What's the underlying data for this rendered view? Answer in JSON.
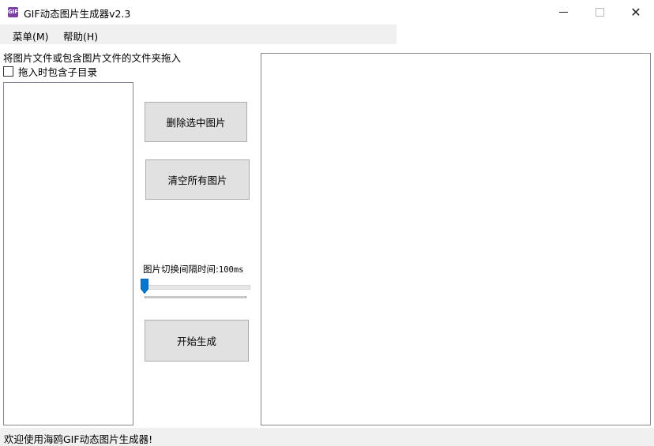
{
  "window": {
    "title": "GIF动态图片生成器v2.3",
    "icon_text": "GIF",
    "minimize_glyph": "—",
    "close_glyph": "✕"
  },
  "menu": {
    "items": [
      {
        "label": "菜单(M)"
      },
      {
        "label": "帮助(H)"
      }
    ]
  },
  "left_panel": {
    "hint": "将图片文件或包含图片文件的文件夹拖入",
    "checkbox_label": "拖入时包含子目录",
    "checkbox_checked": false
  },
  "actions": {
    "delete_selected": "删除选中图片",
    "clear_all": "清空所有图片",
    "start": "开始生成"
  },
  "interval": {
    "label": "图片切换间隔时间:",
    "value": "100ms",
    "slider_fraction": 0
  },
  "status": {
    "text": "欢迎使用海鸥GIF动态图片生成器!"
  },
  "colors": {
    "accent": "#0078d7",
    "button_bg": "#e1e1e1",
    "chrome_bg": "#f0f0f0",
    "icon_bg": "#7b3fa0"
  }
}
